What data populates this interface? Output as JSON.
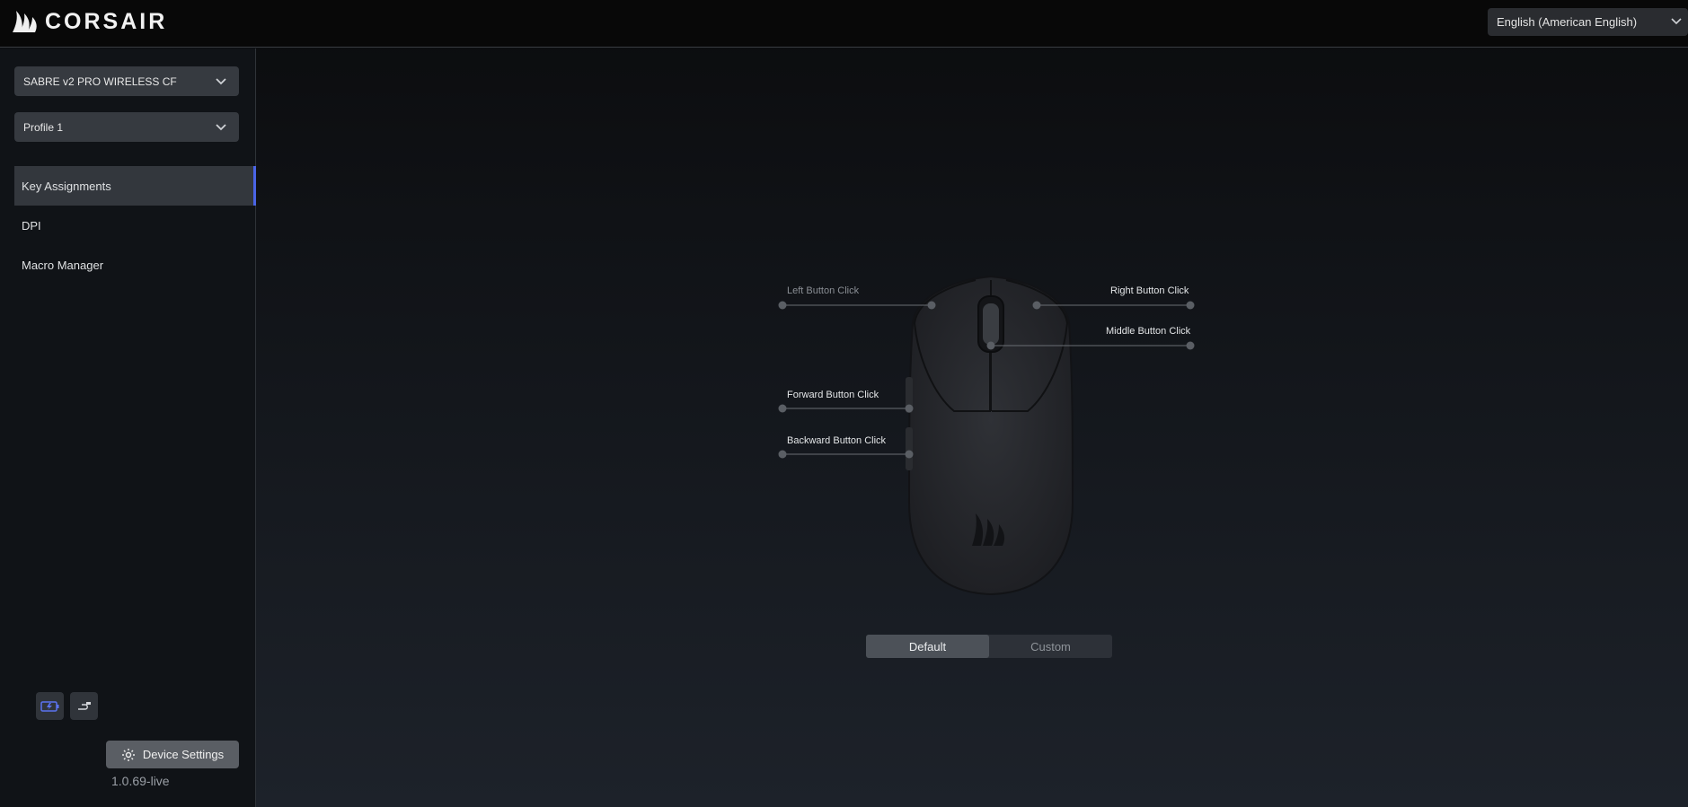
{
  "header": {
    "brand": "CORSAIR",
    "language": "English (American English)"
  },
  "sidebar": {
    "device": "SABRE v2 PRO WIRELESS CF",
    "profile": "Profile 1",
    "items": [
      {
        "label": "Key Assignments",
        "active": true
      },
      {
        "label": "DPI",
        "active": false
      },
      {
        "label": "Macro Manager",
        "active": false
      }
    ],
    "device_settings_label": "Device Settings",
    "version": "1.0.69-live"
  },
  "mouse": {
    "callouts": {
      "left": "Left Button Click",
      "right": "Right Button Click",
      "middle": "Middle Button Click",
      "forward": "Forward Button Click",
      "backward": "Backward Button Click"
    }
  },
  "mode_toggle": {
    "default_label": "Default",
    "custom_label": "Custom",
    "selected": "Default"
  },
  "colors": {
    "accent": "#4a64e6",
    "battery_icon": "#5b73f0"
  },
  "icons": [
    "corsair-sails-icon",
    "chevron-down-icon",
    "battery-charging-icon",
    "usb-cable-icon",
    "gear-icon"
  ]
}
